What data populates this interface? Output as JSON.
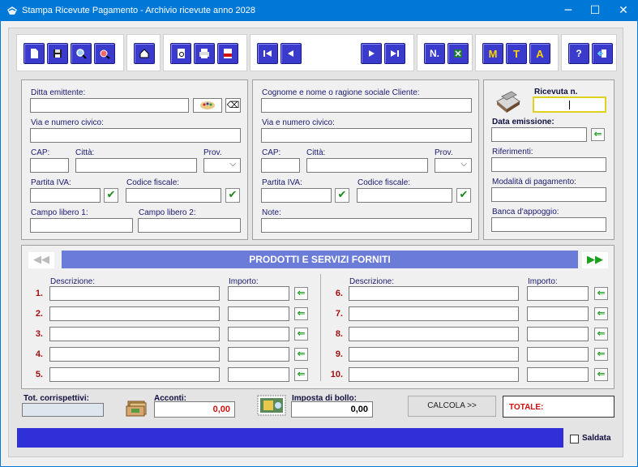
{
  "window": {
    "title": "Stampa Ricevute Pagamento - Archivio ricevute anno 2028",
    "controls": {
      "minimize": "─",
      "maximize": "☐",
      "close": "✕"
    }
  },
  "toolbar": {
    "buttons": [
      {
        "name": "new",
        "icon": "new-document-icon"
      },
      {
        "name": "save",
        "icon": "save-icon"
      },
      {
        "name": "search",
        "icon": "search-icon"
      },
      {
        "name": "search-delete",
        "icon": "search-delete-icon"
      },
      {
        "name": "home",
        "icon": "home-icon"
      },
      {
        "name": "preview",
        "icon": "print-preview-icon"
      },
      {
        "name": "print",
        "icon": "printer-icon"
      },
      {
        "name": "pdf",
        "icon": "pdf-icon"
      },
      {
        "name": "first",
        "icon": "first-record-icon"
      },
      {
        "name": "prev",
        "icon": "previous-record-icon"
      },
      {
        "name": "next",
        "icon": "next-record-icon"
      },
      {
        "name": "last",
        "icon": "last-record-icon"
      },
      {
        "name": "numbering",
        "label": "N."
      },
      {
        "name": "excel",
        "icon": "excel-icon"
      },
      {
        "name": "m",
        "label": "M"
      },
      {
        "name": "t",
        "label": "T"
      },
      {
        "name": "a",
        "label": "A"
      },
      {
        "name": "help",
        "label": "?"
      },
      {
        "name": "exit",
        "icon": "exit-icon"
      }
    ]
  },
  "issuer": {
    "company_label": "Ditta emittente:",
    "address_label": "Via e numero civico:",
    "cap_label": "CAP:",
    "city_label": "Città:",
    "prov_label": "Prov.",
    "vat_label": "Partita IVA:",
    "fiscal_label": "Codice fiscale:",
    "free1_label": "Campo libero 1:",
    "free2_label": "Campo libero 2:"
  },
  "client": {
    "name_label": "Cognome e nome o ragione sociale Cliente:",
    "address_label": "Via e numero civico:",
    "cap_label": "CAP:",
    "city_label": "Città:",
    "prov_label": "Prov.",
    "vat_label": "Partita IVA:",
    "fiscal_label": "Codice fiscale:",
    "notes_label": "Note:"
  },
  "receipt": {
    "number_label": "Ricevuta n.",
    "date_label": "Data emissione:",
    "references_label": "Riferimenti:",
    "payment_label": "Modalità di pagamento:",
    "bank_label": "Banca d'appoggio:"
  },
  "products": {
    "banner": "PRODOTTI E SERVIZI FORNITI",
    "desc_label": "Descrizione:",
    "amount_label": "Importo:",
    "left_rows": [
      "1.",
      "2.",
      "3.",
      "4.",
      "5."
    ],
    "right_rows": [
      "6.",
      "7.",
      "8.",
      "9.",
      "10."
    ],
    "nav_prev": "◀◀",
    "nav_next": "▶▶"
  },
  "totals": {
    "consideration_label": "Tot. corrispettivi:",
    "deposits_label": "Acconti:",
    "deposits_value": "0,00",
    "stamp_label": "Imposta di bollo:",
    "stamp_value": "0,00",
    "calc_button": "CALCOLA >>",
    "total_label": "TOTALE:"
  },
  "footer": {
    "paid_label": "Saldata"
  },
  "colors": {
    "button_blue": "#3a3acc",
    "banner": "#6b7bd8",
    "status_bar": "#3030d8",
    "label_text": "#1a1a6e",
    "row_number": "#a01010",
    "amount_text": "#d01010"
  }
}
